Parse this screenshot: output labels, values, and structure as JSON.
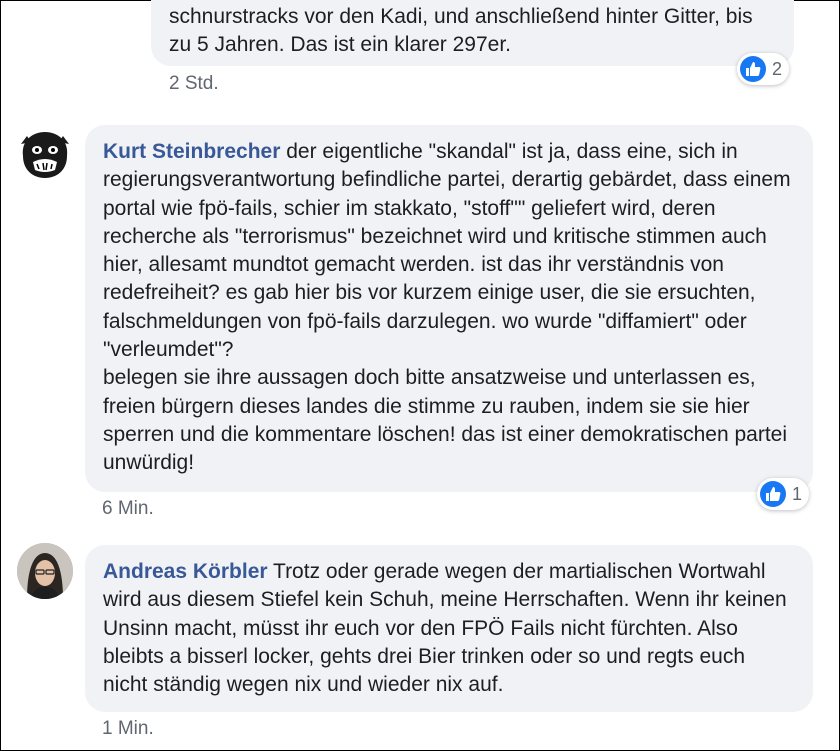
{
  "comments": [
    {
      "author": "",
      "text": "schnurstracks vor den Kadi, und anschließend hinter Gitter, bis zu 5 Jahren. Das ist ein klarer 297er.",
      "time": "2 Std.",
      "reaction": {
        "icon": "like-icon",
        "count": "2"
      }
    },
    {
      "author": "Kurt Steinbrecher",
      "text_lines": [
        "der eigentliche \"skandal\" ist ja, dass eine, sich in regierungsverantwortung befindliche partei, derartig gebärdet, dass einem portal wie fpö-fails, schier im stakkato, \"stoff\"\" geliefert wird, deren recherche als \"terrorismus\" bezeichnet wird und kritische stimmen auch hier, allesamt mundtot gemacht werden. ist das ihr verständnis von redefreiheit? es gab hier bis vor kurzem einige user, die sie ersuchten, falschmeldungen von fpö-fails darzulegen. wo wurde \"diffamiert\" oder \"verleumdet\"?",
        "belegen sie ihre aussagen doch bitte ansatzweise und unterlassen es, freien bürgern dieses landes die stimme zu rauben, indem sie sie hier sperren und die kommentare löschen! das ist einer demokratischen partei unwürdig!"
      ],
      "time": "6 Min.",
      "reaction": {
        "icon": "like-icon",
        "count": "1"
      }
    },
    {
      "author": "Andreas Körbler",
      "text": "Trotz oder gerade wegen der martialischen Wortwahl wird aus diesem Stiefel kein Schuh, meine Herrschaften. Wenn ihr keinen Unsinn macht, müsst ihr euch vor den FPÖ Fails nicht fürchten. Also bleibts a bisserl locker, gehts drei Bier trinken oder so und regts euch nicht ständig wegen nix und wieder nix auf.",
      "time": "1 Min."
    }
  ],
  "colors": {
    "author": "#385898",
    "bubble": "#f0f2f5",
    "like": "#1877f2"
  }
}
